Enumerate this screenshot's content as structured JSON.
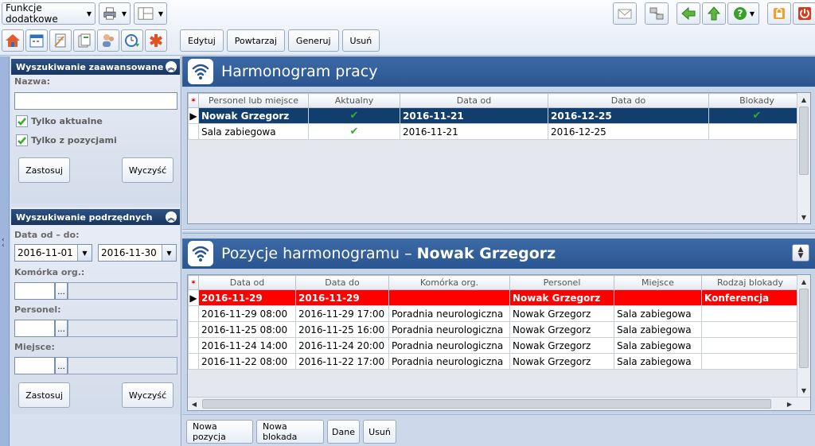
{
  "toolbar": {
    "extra_functions": "Funkcje dodatkowe",
    "edit": "Edytuj",
    "repeat": "Powtarzaj",
    "generate": "Generuj",
    "delete": "Usuń"
  },
  "left": {
    "advanced_search": {
      "title": "Wyszukiwanie zaawansowane",
      "name_label": "Nazwa:",
      "name_value": "",
      "only_current": "Tylko aktualne",
      "only_with_items": "Tylko z pozycjami",
      "apply": "Zastosuj",
      "clear": "Wyczyść"
    },
    "sub_search": {
      "title": "Wyszukiwanie podrzędnych",
      "date_label": "Data od – do:",
      "date_from": "2016-11-01",
      "date_to": "2016-11-30",
      "org_label": "Komórka org.:",
      "staff_label": "Personel:",
      "place_label": "Miejsce:",
      "apply": "Zastosuj",
      "clear": "Wyczyść"
    }
  },
  "schedule": {
    "title": "Harmonogram pracy",
    "columns": [
      "Personel lub miejsce",
      "Aktualny",
      "Data od",
      "Data do",
      "Blokady"
    ],
    "rows": [
      {
        "name": "Nowak Grzegorz",
        "from": "2016-11-21",
        "to": "2016-12-25"
      },
      {
        "name": "Sala zabiegowa",
        "from": "2016-11-21",
        "to": "2016-12-25"
      }
    ]
  },
  "positions": {
    "title_prefix": "Pozycje harmonogramu –",
    "title_name": "Nowak Grzegorz",
    "columns": [
      "Data od",
      "Data do",
      "Komórka org.",
      "Personel",
      "Miejsce",
      "Rodzaj blokady"
    ],
    "rows": [
      {
        "from": "2016-11-29",
        "to": "2016-11-29",
        "org": "",
        "staff": "Nowak Grzegorz",
        "place": "",
        "block": "Konferencja"
      },
      {
        "from": "2016-11-29 08:00",
        "to": "2016-11-29 17:00",
        "org": "Poradnia neurologiczna",
        "staff": "Nowak Grzegorz",
        "place": "Sala zabiegowa",
        "block": ""
      },
      {
        "from": "2016-11-25 08:00",
        "to": "2016-11-25 16:00",
        "org": "Poradnia neurologiczna",
        "staff": "Nowak Grzegorz",
        "place": "Sala zabiegowa",
        "block": ""
      },
      {
        "from": "2016-11-24 14:00",
        "to": "2016-11-24 20:00",
        "org": "Poradnia neurologiczna",
        "staff": "Nowak Grzegorz",
        "place": "Sala zabiegowa",
        "block": ""
      },
      {
        "from": "2016-11-22 08:00",
        "to": "2016-11-22 17:00",
        "org": "Poradnia neurologiczna",
        "staff": "Nowak Grzegorz",
        "place": "Sala zabiegowa",
        "block": ""
      }
    ],
    "new_position": "Nowa pozycja",
    "new_block": "Nowa blokada",
    "data": "Dane",
    "delete": "Usuń"
  },
  "colors": {
    "header_blue": "#2a5590",
    "selected_row": "#123e6e",
    "block_row": "#ff0000",
    "check_green": "#3aaa2a"
  },
  "icons": [
    "home-icon",
    "calendar-icon",
    "notepad-icon",
    "documents-icon",
    "people-icon",
    "clock-arrow-icon",
    "medical-star-icon",
    "printer-icon",
    "layout-icon",
    "mail-icon",
    "network-icon",
    "back-arrow-icon",
    "up-arrow-icon",
    "help-icon",
    "lock-icon",
    "power-icon"
  ]
}
